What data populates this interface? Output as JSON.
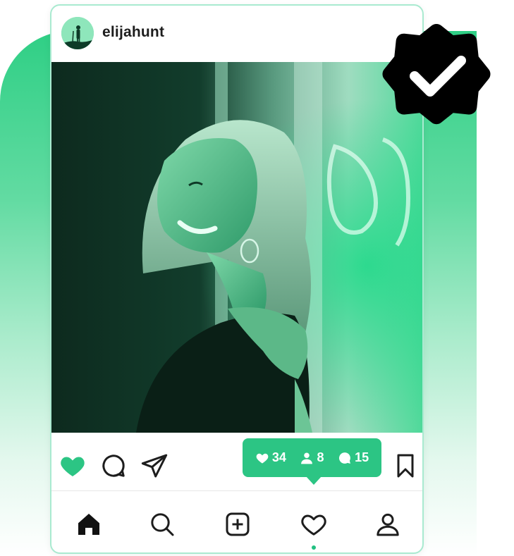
{
  "post": {
    "username": "elijahunt"
  },
  "stats": {
    "likes": "34",
    "followers": "8",
    "comments": "15"
  },
  "actions": [
    "heart-icon",
    "comment-icon",
    "send-icon",
    "bookmark-icon"
  ],
  "nav": [
    "home-icon",
    "search-icon",
    "add-post-icon",
    "activity-icon",
    "profile-icon"
  ],
  "colors": {
    "accent": "#2cc584",
    "accent_light": "#a9ead0",
    "badge": "#000000",
    "text": "#1d1d1d"
  }
}
